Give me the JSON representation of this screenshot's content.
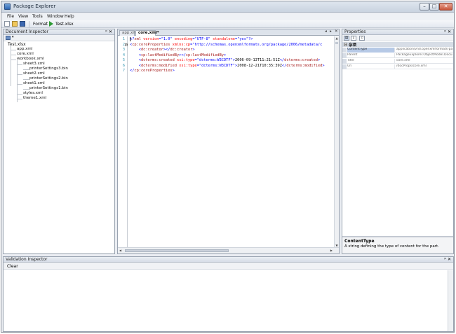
{
  "window": {
    "title": "Package Explorer",
    "controls": {
      "minimize": "–",
      "maximize": "□",
      "close": "✕"
    }
  },
  "menu": [
    "File",
    "View",
    "Tools",
    "Window",
    "Help"
  ],
  "toolbar": {
    "format_label": "Format",
    "file_label": "Test.xlsx",
    "icons": [
      "new-icon",
      "open-icon",
      "save-icon",
      "run-icon"
    ]
  },
  "document_inspector": {
    "title": "Document Inspector",
    "pin": "ᵖ",
    "close": "✕",
    "tree": [
      {
        "label": "Test.xlsx",
        "depth": 0
      },
      {
        "label": "app.xml",
        "depth": 1
      },
      {
        "label": "core.xml",
        "depth": 1
      },
      {
        "label": "workbook.xml",
        "depth": 1
      },
      {
        "label": "sheet3.xml",
        "depth": 2
      },
      {
        "label": "printerSettings3.bin",
        "depth": 3
      },
      {
        "label": "sheet2.xml",
        "depth": 2
      },
      {
        "label": "printerSettings2.bin",
        "depth": 3
      },
      {
        "label": "sheet1.xml",
        "depth": 2
      },
      {
        "label": "printerSettings1.bin",
        "depth": 3
      },
      {
        "label": "styles.xml",
        "depth": 2
      },
      {
        "label": "theme1.xml",
        "depth": 2
      }
    ]
  },
  "editor": {
    "tabs": [
      {
        "label": "app.xml*",
        "active": false
      },
      {
        "label": "core.xml*",
        "active": true
      }
    ],
    "tab_controls": {
      "prev": "◂",
      "next": "▸",
      "close": "✕"
    },
    "lines": [
      {
        "num": "1",
        "fold": "",
        "segs": [
          [
            "pun",
            "<?"
          ],
          [
            "tag",
            "xml"
          ],
          [
            "attr",
            " version"
          ],
          [
            "pun",
            "="
          ],
          [
            "val",
            "\"1.0\""
          ],
          [
            "attr",
            " encoding"
          ],
          [
            "pun",
            "="
          ],
          [
            "val",
            "\"UTF-8\""
          ],
          [
            "attr",
            " standalone"
          ],
          [
            "pun",
            "="
          ],
          [
            "val",
            "\"yes\""
          ],
          [
            "pun",
            "?>"
          ]
        ]
      },
      {
        "num": "2",
        "fold": "−",
        "segs": [
          [
            "pun",
            "<"
          ],
          [
            "tag",
            "cp:coreProperties"
          ],
          [
            "attr",
            " xmlns:cp"
          ],
          [
            "pun",
            "="
          ],
          [
            "val",
            "\"http://schemas.openxmlformats.org/package/2006/metadata/c"
          ]
        ]
      },
      {
        "num": "3",
        "fold": "",
        "segs": [
          [
            "txt",
            "    "
          ],
          [
            "pun",
            "<"
          ],
          [
            "tag",
            "dc:creator"
          ],
          [
            "pun",
            "></"
          ],
          [
            "tag",
            "dc:creator"
          ],
          [
            "pun",
            ">"
          ]
        ]
      },
      {
        "num": "4",
        "fold": "",
        "segs": [
          [
            "txt",
            "    "
          ],
          [
            "pun",
            "<"
          ],
          [
            "tag",
            "cp:lastModifiedBy"
          ],
          [
            "pun",
            "></"
          ],
          [
            "tag",
            "cp:lastModifiedBy"
          ],
          [
            "pun",
            ">"
          ]
        ]
      },
      {
        "num": "5",
        "fold": "",
        "segs": [
          [
            "txt",
            "    "
          ],
          [
            "pun",
            "<"
          ],
          [
            "tag",
            "dcterms:created"
          ],
          [
            "attr",
            " xsi:type"
          ],
          [
            "pun",
            "="
          ],
          [
            "val",
            "\"dcterms:W3CDTF\""
          ],
          [
            "pun",
            ">"
          ],
          [
            "txt",
            "2006-09-13T11:21:51Z"
          ],
          [
            "pun",
            "</"
          ],
          [
            "tag",
            "dcterms:created"
          ],
          [
            "pun",
            ">"
          ]
        ]
      },
      {
        "num": "6",
        "fold": "",
        "segs": [
          [
            "txt",
            "    "
          ],
          [
            "pun",
            "<"
          ],
          [
            "tag",
            "dcterms:modified"
          ],
          [
            "attr",
            " xsi:type"
          ],
          [
            "pun",
            "="
          ],
          [
            "val",
            "\"dcterms:W3CDTF\""
          ],
          [
            "pun",
            ">"
          ],
          [
            "txt",
            "2008-12-21T10:35:39Z"
          ],
          [
            "pun",
            "</"
          ],
          [
            "tag",
            "dcterms:modified"
          ],
          [
            "pun",
            ">"
          ]
        ]
      },
      {
        "num": "7",
        "fold": "",
        "segs": [
          [
            "pun",
            "</"
          ],
          [
            "tag",
            "cp:coreProperties"
          ],
          [
            "pun",
            ">"
          ]
        ]
      }
    ]
  },
  "properties": {
    "title": "Properties",
    "category": "杂项",
    "rows": [
      {
        "name": "ContentType",
        "value": "application/vnd.openxmlformats-package",
        "selected": true
      },
      {
        "name": "Parent",
        "value": "PackageExplorer.ObjectModel.Docum",
        "selected": false
      },
      {
        "name": "Title",
        "value": "core.xml",
        "selected": false
      },
      {
        "name": "Uri",
        "value": "/docProps/core.xml",
        "selected": false
      }
    ],
    "description": {
      "title": "ContentType",
      "text": "A string defining the type of content for the part."
    }
  },
  "validation": {
    "title": "Validation Inspector",
    "clear_label": "Clear"
  },
  "colors": {
    "tag": "#a31515",
    "attr": "#ff0000",
    "value": "#0000ff",
    "line_number": "#2b91af"
  }
}
